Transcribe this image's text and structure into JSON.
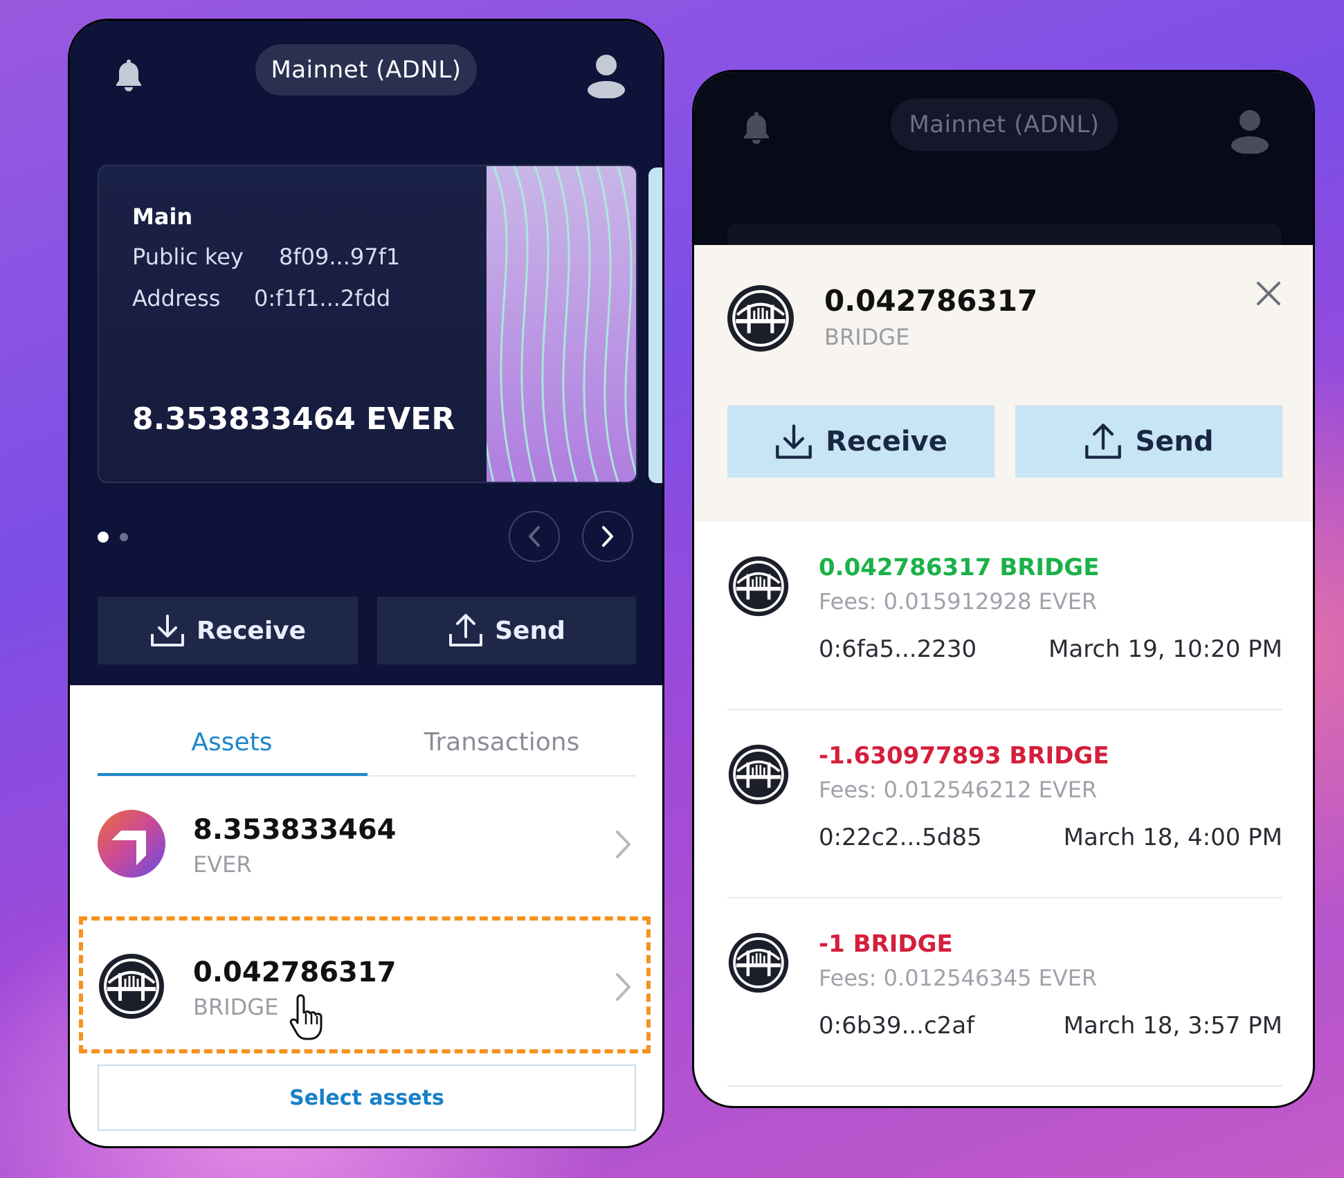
{
  "colors": {
    "navy": "#0d1339",
    "accent_blue": "#1880c8",
    "positive": "#1bb148",
    "negative": "#d51e3c",
    "highlight": "#f5921e",
    "light_button": "#c7e5f4"
  },
  "left": {
    "network": "Mainnet (ADNL)",
    "account": {
      "name": "Main",
      "public_key_label": "Public key",
      "public_key": "8f09...97f1",
      "address_label": "Address",
      "address": "0:f1f1...2fdd",
      "balance": "8.353833464 EVER"
    },
    "actions": {
      "receive": "Receive",
      "send": "Send"
    },
    "tabs": {
      "assets": "Assets",
      "transactions": "Transactions"
    },
    "assets": [
      {
        "amount": "8.353833464",
        "symbol": "EVER",
        "icon": "ever-logo-icon"
      },
      {
        "amount": "0.042786317",
        "symbol": "BRIDGE",
        "icon": "bridge-logo-icon"
      }
    ],
    "select_assets": "Select assets"
  },
  "right": {
    "network": "Mainnet (ADNL)",
    "token": {
      "amount": "0.042786317",
      "symbol": "BRIDGE"
    },
    "actions": {
      "receive": "Receive",
      "send": "Send"
    },
    "transactions": [
      {
        "amount": "0.042786317 BRIDGE",
        "type": "in",
        "fees": "Fees: 0.015912928 EVER",
        "address": "0:6fa5...2230",
        "date": "March 19, 10:20 PM"
      },
      {
        "amount": "-1.630977893 BRIDGE",
        "type": "out",
        "fees": "Fees: 0.012546212 EVER",
        "address": "0:22c2...5d85",
        "date": "March 18, 4:00 PM"
      },
      {
        "amount": "-1 BRIDGE",
        "type": "out",
        "fees": "Fees: 0.012546345 EVER",
        "address": "0:6b39...c2af",
        "date": "March 18, 3:57 PM"
      }
    ]
  }
}
